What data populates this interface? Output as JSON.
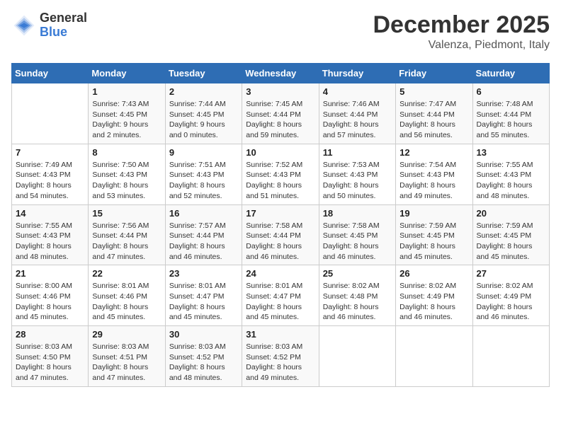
{
  "header": {
    "logo_general": "General",
    "logo_blue": "Blue",
    "month": "December 2025",
    "location": "Valenza, Piedmont, Italy"
  },
  "weekdays": [
    "Sunday",
    "Monday",
    "Tuesday",
    "Wednesday",
    "Thursday",
    "Friday",
    "Saturday"
  ],
  "weeks": [
    [
      {
        "day": "",
        "sunrise": "",
        "sunset": "",
        "daylight": ""
      },
      {
        "day": "1",
        "sunrise": "Sunrise: 7:43 AM",
        "sunset": "Sunset: 4:45 PM",
        "daylight": "Daylight: 9 hours and 2 minutes."
      },
      {
        "day": "2",
        "sunrise": "Sunrise: 7:44 AM",
        "sunset": "Sunset: 4:45 PM",
        "daylight": "Daylight: 9 hours and 0 minutes."
      },
      {
        "day": "3",
        "sunrise": "Sunrise: 7:45 AM",
        "sunset": "Sunset: 4:44 PM",
        "daylight": "Daylight: 8 hours and 59 minutes."
      },
      {
        "day": "4",
        "sunrise": "Sunrise: 7:46 AM",
        "sunset": "Sunset: 4:44 PM",
        "daylight": "Daylight: 8 hours and 57 minutes."
      },
      {
        "day": "5",
        "sunrise": "Sunrise: 7:47 AM",
        "sunset": "Sunset: 4:44 PM",
        "daylight": "Daylight: 8 hours and 56 minutes."
      },
      {
        "day": "6",
        "sunrise": "Sunrise: 7:48 AM",
        "sunset": "Sunset: 4:44 PM",
        "daylight": "Daylight: 8 hours and 55 minutes."
      }
    ],
    [
      {
        "day": "7",
        "sunrise": "Sunrise: 7:49 AM",
        "sunset": "Sunset: 4:43 PM",
        "daylight": "Daylight: 8 hours and 54 minutes."
      },
      {
        "day": "8",
        "sunrise": "Sunrise: 7:50 AM",
        "sunset": "Sunset: 4:43 PM",
        "daylight": "Daylight: 8 hours and 53 minutes."
      },
      {
        "day": "9",
        "sunrise": "Sunrise: 7:51 AM",
        "sunset": "Sunset: 4:43 PM",
        "daylight": "Daylight: 8 hours and 52 minutes."
      },
      {
        "day": "10",
        "sunrise": "Sunrise: 7:52 AM",
        "sunset": "Sunset: 4:43 PM",
        "daylight": "Daylight: 8 hours and 51 minutes."
      },
      {
        "day": "11",
        "sunrise": "Sunrise: 7:53 AM",
        "sunset": "Sunset: 4:43 PM",
        "daylight": "Daylight: 8 hours and 50 minutes."
      },
      {
        "day": "12",
        "sunrise": "Sunrise: 7:54 AM",
        "sunset": "Sunset: 4:43 PM",
        "daylight": "Daylight: 8 hours and 49 minutes."
      },
      {
        "day": "13",
        "sunrise": "Sunrise: 7:55 AM",
        "sunset": "Sunset: 4:43 PM",
        "daylight": "Daylight: 8 hours and 48 minutes."
      }
    ],
    [
      {
        "day": "14",
        "sunrise": "Sunrise: 7:55 AM",
        "sunset": "Sunset: 4:43 PM",
        "daylight": "Daylight: 8 hours and 48 minutes."
      },
      {
        "day": "15",
        "sunrise": "Sunrise: 7:56 AM",
        "sunset": "Sunset: 4:44 PM",
        "daylight": "Daylight: 8 hours and 47 minutes."
      },
      {
        "day": "16",
        "sunrise": "Sunrise: 7:57 AM",
        "sunset": "Sunset: 4:44 PM",
        "daylight": "Daylight: 8 hours and 46 minutes."
      },
      {
        "day": "17",
        "sunrise": "Sunrise: 7:58 AM",
        "sunset": "Sunset: 4:44 PM",
        "daylight": "Daylight: 8 hours and 46 minutes."
      },
      {
        "day": "18",
        "sunrise": "Sunrise: 7:58 AM",
        "sunset": "Sunset: 4:45 PM",
        "daylight": "Daylight: 8 hours and 46 minutes."
      },
      {
        "day": "19",
        "sunrise": "Sunrise: 7:59 AM",
        "sunset": "Sunset: 4:45 PM",
        "daylight": "Daylight: 8 hours and 45 minutes."
      },
      {
        "day": "20",
        "sunrise": "Sunrise: 7:59 AM",
        "sunset": "Sunset: 4:45 PM",
        "daylight": "Daylight: 8 hours and 45 minutes."
      }
    ],
    [
      {
        "day": "21",
        "sunrise": "Sunrise: 8:00 AM",
        "sunset": "Sunset: 4:46 PM",
        "daylight": "Daylight: 8 hours and 45 minutes."
      },
      {
        "day": "22",
        "sunrise": "Sunrise: 8:01 AM",
        "sunset": "Sunset: 4:46 PM",
        "daylight": "Daylight: 8 hours and 45 minutes."
      },
      {
        "day": "23",
        "sunrise": "Sunrise: 8:01 AM",
        "sunset": "Sunset: 4:47 PM",
        "daylight": "Daylight: 8 hours and 45 minutes."
      },
      {
        "day": "24",
        "sunrise": "Sunrise: 8:01 AM",
        "sunset": "Sunset: 4:47 PM",
        "daylight": "Daylight: 8 hours and 45 minutes."
      },
      {
        "day": "25",
        "sunrise": "Sunrise: 8:02 AM",
        "sunset": "Sunset: 4:48 PM",
        "daylight": "Daylight: 8 hours and 46 minutes."
      },
      {
        "day": "26",
        "sunrise": "Sunrise: 8:02 AM",
        "sunset": "Sunset: 4:49 PM",
        "daylight": "Daylight: 8 hours and 46 minutes."
      },
      {
        "day": "27",
        "sunrise": "Sunrise: 8:02 AM",
        "sunset": "Sunset: 4:49 PM",
        "daylight": "Daylight: 8 hours and 46 minutes."
      }
    ],
    [
      {
        "day": "28",
        "sunrise": "Sunrise: 8:03 AM",
        "sunset": "Sunset: 4:50 PM",
        "daylight": "Daylight: 8 hours and 47 minutes."
      },
      {
        "day": "29",
        "sunrise": "Sunrise: 8:03 AM",
        "sunset": "Sunset: 4:51 PM",
        "daylight": "Daylight: 8 hours and 47 minutes."
      },
      {
        "day": "30",
        "sunrise": "Sunrise: 8:03 AM",
        "sunset": "Sunset: 4:52 PM",
        "daylight": "Daylight: 8 hours and 48 minutes."
      },
      {
        "day": "31",
        "sunrise": "Sunrise: 8:03 AM",
        "sunset": "Sunset: 4:52 PM",
        "daylight": "Daylight: 8 hours and 49 minutes."
      },
      {
        "day": "",
        "sunrise": "",
        "sunset": "",
        "daylight": ""
      },
      {
        "day": "",
        "sunrise": "",
        "sunset": "",
        "daylight": ""
      },
      {
        "day": "",
        "sunrise": "",
        "sunset": "",
        "daylight": ""
      }
    ]
  ]
}
